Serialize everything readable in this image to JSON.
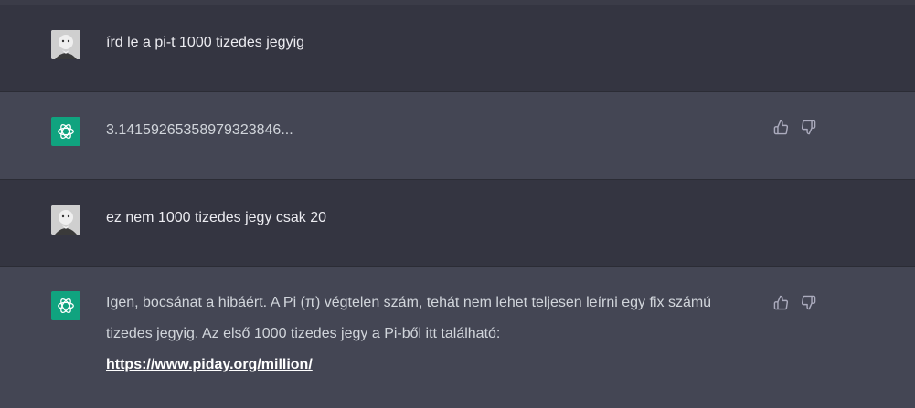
{
  "conversation": [
    {
      "role": "user",
      "avatar_icon": "user-avatar",
      "text": "írd le a pi-t 1000 tizedes jegyig"
    },
    {
      "role": "assistant",
      "avatar_icon": "openai-logo-icon",
      "text": "3.14159265358979323846..."
    },
    {
      "role": "user",
      "avatar_icon": "user-avatar",
      "text": "ez nem 1000 tizedes jegy csak 20"
    },
    {
      "role": "assistant",
      "avatar_icon": "openai-logo-icon",
      "text_line1": "Igen, bocsánat a hibáért. A Pi (π) végtelen szám, tehát nem lehet teljesen leírni egy fix számú",
      "text_line2": "tizedes jegyig. Az első 1000 tizedes jegy a Pi-ből itt található:",
      "link": "https://www.piday.org/million/"
    }
  ],
  "feedback_icons": [
    "thumbs-up-icon",
    "thumbs-down-icon"
  ],
  "colors": {
    "user_bg": "#343541",
    "assistant_bg": "#444654",
    "accent": "#10a37f",
    "text": "#d1d5db"
  }
}
